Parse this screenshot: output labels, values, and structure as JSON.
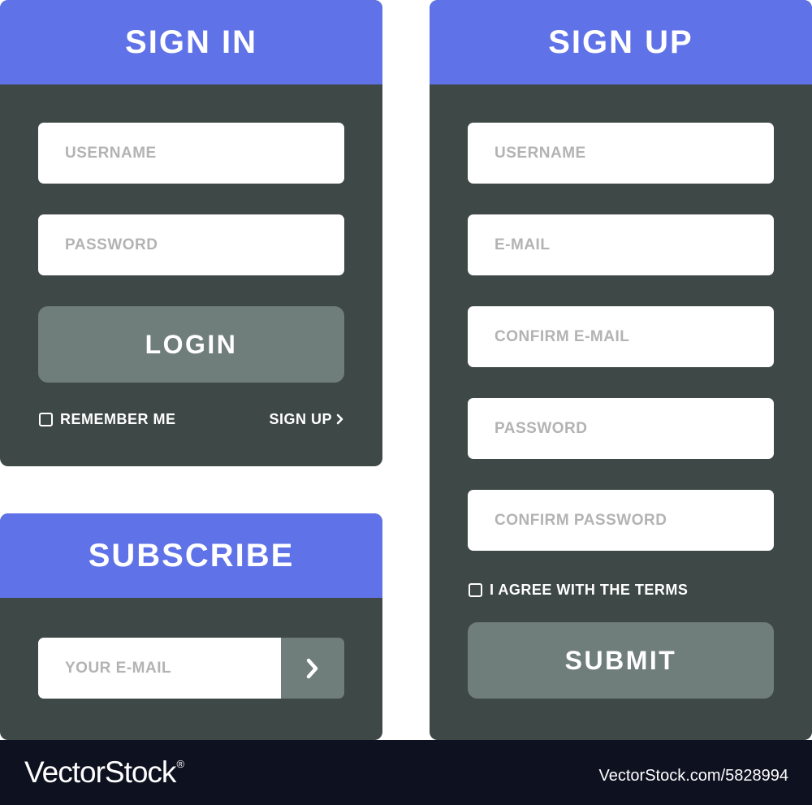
{
  "signin": {
    "title": "SIGN IN",
    "username_placeholder": "USERNAME",
    "password_placeholder": "PASSWORD",
    "login_label": "LOGIN",
    "remember_label": "REMEMBER ME",
    "signup_link": "SIGN UP"
  },
  "subscribe": {
    "title": "SUBSCRIBE",
    "email_placeholder": "YOUR E-MAIL"
  },
  "signup": {
    "title": "SIGN UP",
    "username_placeholder": "USERNAME",
    "email_placeholder": "E-MAIL",
    "confirm_email_placeholder": "CONFIRM E-MAIL",
    "password_placeholder": "PASSWORD",
    "confirm_password_placeholder": "CONFIRM PASSWORD",
    "terms_label": "I AGREE WITH THE TERMS",
    "submit_label": "SUBMIT"
  },
  "footer": {
    "brand": "VectorStock",
    "reg_mark": "®",
    "image_id": "VectorStock.com/5828994"
  },
  "colors": {
    "header": "#5f72e7",
    "panel": "#3e4846",
    "button": "#6f7d7b",
    "footer": "#0e1120"
  }
}
